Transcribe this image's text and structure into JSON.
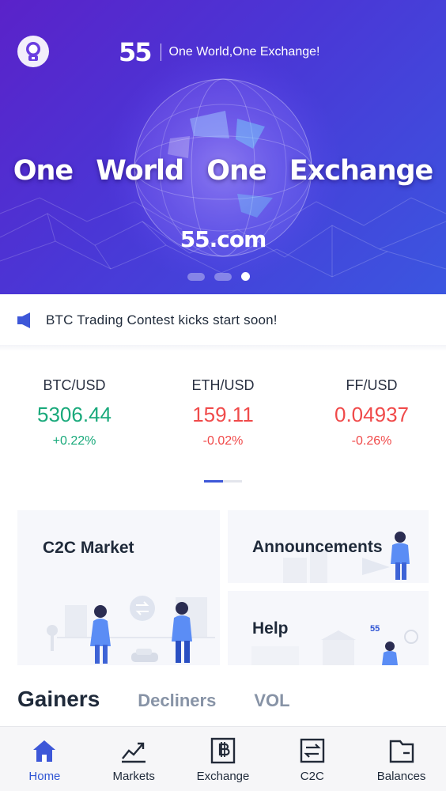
{
  "banner": {
    "brand_logo": "55",
    "tagline": "One World,One Exchange!",
    "headline": "One World One Exchange",
    "domain": "55.com",
    "slide_count": 3,
    "active_slide": 3
  },
  "notice": {
    "icon": "speaker-icon",
    "text": "BTC Trading Contest kicks start soon!"
  },
  "tickers": [
    {
      "pair": "BTC/USD",
      "price": "5306.44",
      "change": "+0.22%",
      "direction": "up"
    },
    {
      "pair": "ETH/USD",
      "price": "159.11",
      "change": "-0.02%",
      "direction": "down"
    },
    {
      "pair": "FF/USD",
      "price": "0.04937",
      "change": "-0.26%",
      "direction": "down"
    }
  ],
  "cards": {
    "c2c": "C2C Market",
    "announcements": "Announcements",
    "help": "Help",
    "help_badge": "55"
  },
  "tabs": [
    "Gainers",
    "Decliners",
    "VOL"
  ],
  "nav": [
    {
      "label": "Home",
      "icon": "home-icon",
      "active": true
    },
    {
      "label": "Markets",
      "icon": "chart-icon",
      "active": false
    },
    {
      "label": "Exchange",
      "icon": "bitcoin-icon",
      "active": false
    },
    {
      "label": "C2C",
      "icon": "swap-icon",
      "active": false
    },
    {
      "label": "Balances",
      "icon": "wallet-icon",
      "active": false
    }
  ],
  "colors": {
    "up": "#19a97b",
    "down": "#f04a4a",
    "accent": "#2f55d4",
    "banner_start": "#5a22c9",
    "banner_end": "#3b56e0"
  }
}
